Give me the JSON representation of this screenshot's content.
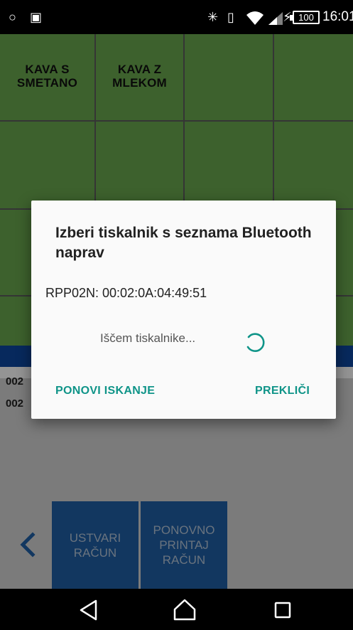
{
  "status_bar": {
    "icons": [
      "location-icon",
      "android-icon",
      "bluetooth-icon",
      "vibrate-icon",
      "wifi-icon",
      "signal-icon",
      "charging-icon"
    ],
    "battery_level": "100",
    "time": "16:01"
  },
  "grid": {
    "accent_color": "#6aa84f",
    "items": [
      {
        "label": "KAVA S\nSMETANO"
      },
      {
        "label": "KAVA Z\nMLEKOM"
      }
    ]
  },
  "list": {
    "rows": [
      "002",
      "002"
    ]
  },
  "actions": {
    "create_receipt": "USTVARI\nRAČUN",
    "reprint_receipt": "PONOVNO\nPRINTAJ\nRAČUN"
  },
  "dialog": {
    "title": "Izberi tiskalnik s seznama Bluetooth naprav",
    "device": "RPP02N: 00:02:0A:04:49:51",
    "searching_text": "Iščem tiskalnike...",
    "retry_button": "PONOVI ISKANJE",
    "cancel_button": "PREKLIČI",
    "button_color": "#0f9488"
  },
  "nav_bar": {
    "icons": [
      "back-icon",
      "home-icon",
      "recents-icon"
    ]
  }
}
